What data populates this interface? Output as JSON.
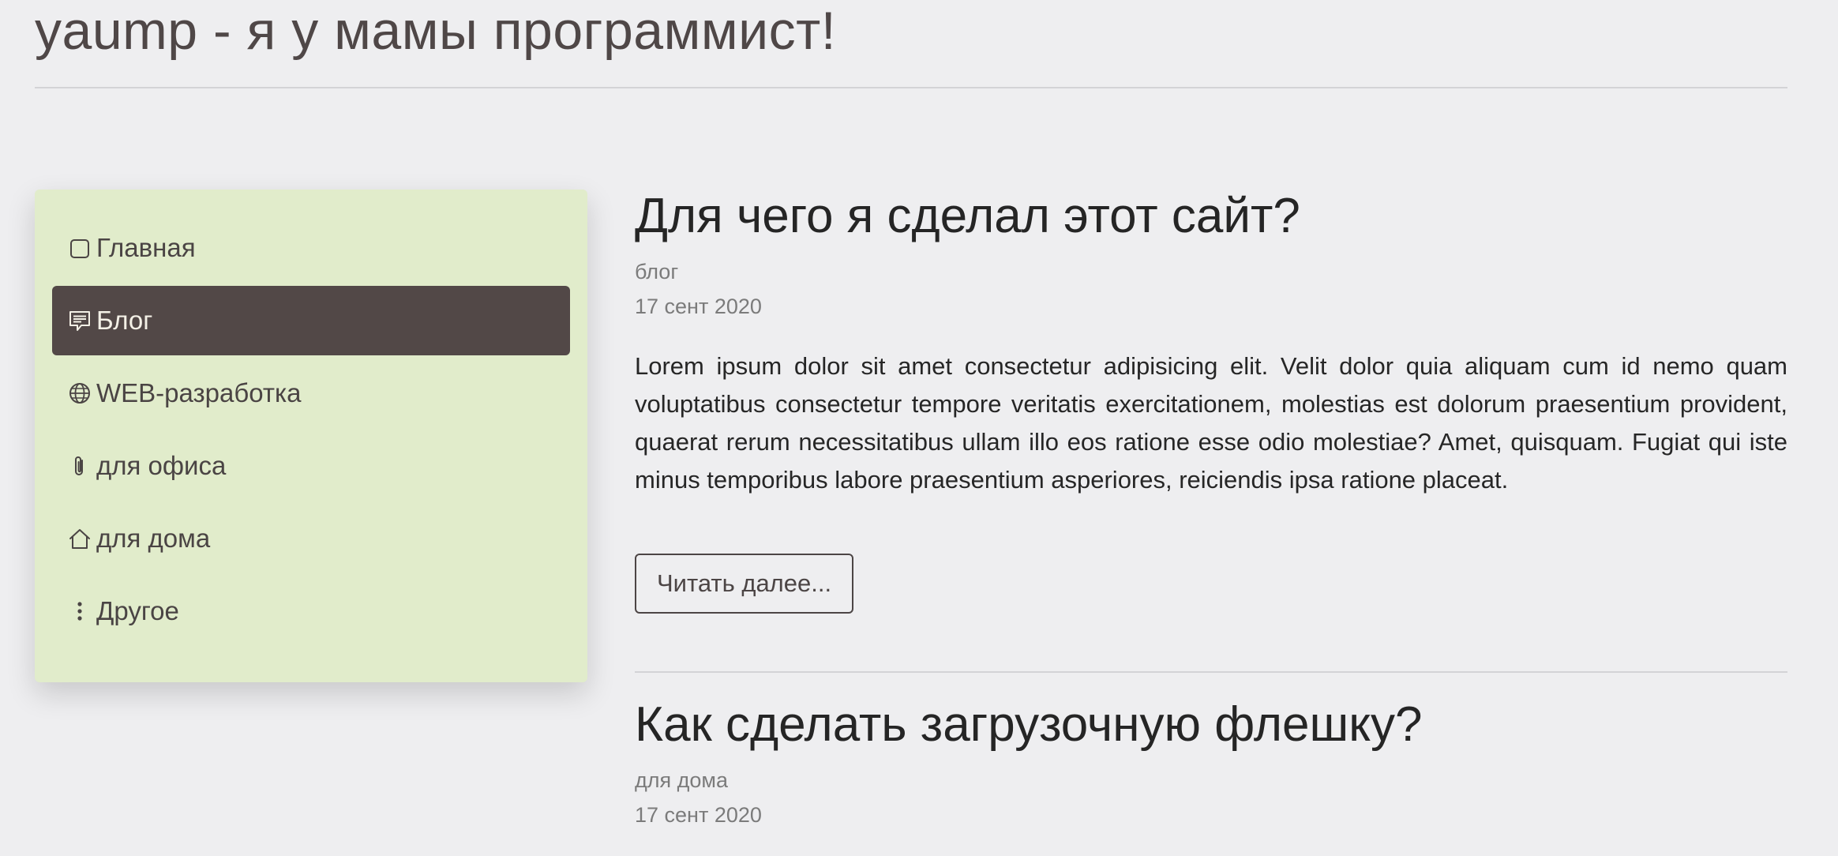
{
  "site": {
    "title": "yaump - я у мамы программист!"
  },
  "sidebar": {
    "items": [
      {
        "label": "Главная",
        "icon": "square-icon",
        "active": false
      },
      {
        "label": "Блог",
        "icon": "chat-icon",
        "active": true
      },
      {
        "label": "WEB-разработка",
        "icon": "globe-icon",
        "active": false
      },
      {
        "label": "для офиса",
        "icon": "paperclip-icon",
        "active": false
      },
      {
        "label": "для дома",
        "icon": "house-icon",
        "active": false
      },
      {
        "label": "Другое",
        "icon": "more-vertical-icon",
        "active": false
      }
    ]
  },
  "posts": [
    {
      "title": "Для чего я сделал этот сайт?",
      "category": "блог",
      "date": "17 сент 2020",
      "excerpt": "Lorem ipsum dolor sit amet consectetur adipisicing elit. Velit dolor quia aliquam cum id nemo quam voluptatibus consectetur tempore veritatis exercitationem, molestias est dolorum praesentium provident, quaerat rerum necessitatibus ullam illo eos ratione esse odio molestiae? Amet, quisquam. Fugiat qui iste minus temporibus labore praesentium asperiores, reiciendis ipsa ratione placeat.",
      "read_more": "Читать далее..."
    },
    {
      "title": "Как сделать загрузочную флешку?",
      "category": "для дома",
      "date": "17 сент 2020"
    }
  ],
  "colors": {
    "background": "#eeeef0",
    "sidebar_bg": "#e1eccb",
    "active_item_bg": "#524847",
    "active_item_text": "#f3f0e6"
  }
}
